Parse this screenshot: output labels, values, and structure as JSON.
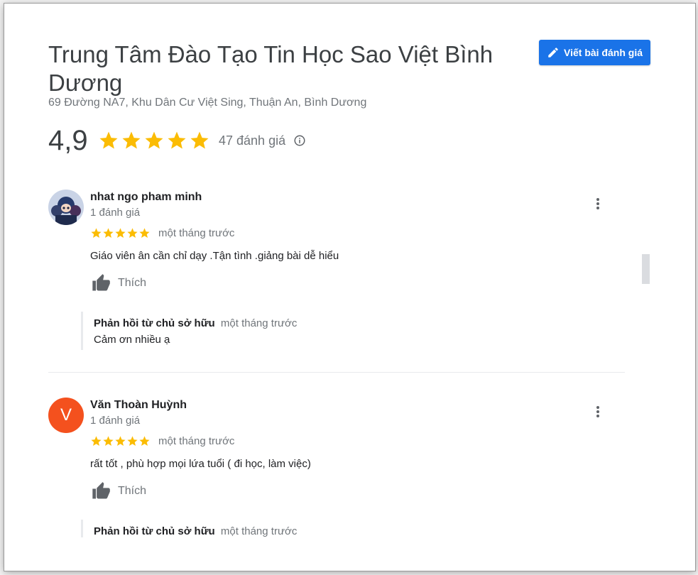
{
  "place": {
    "title": "Trung Tâm Đào Tạo Tin Học Sao Việt Bình Dương",
    "address": "69 Đường NA7, Khu Dân Cư Việt Sing, Thuận An, Bình Dương",
    "rating": "4,9",
    "rating_stars": 5,
    "review_count_label": "47 đánh giá"
  },
  "actions": {
    "write_review_label": "Viết bài đánh giá"
  },
  "reviews": [
    {
      "author": "nhat ngo pham minh",
      "author_reviews": "1 đánh giá",
      "stars": 5,
      "time": "một tháng trước",
      "text": "Giáo viên ân cần chỉ dạy .Tận tình .giảng bài dễ hiểu",
      "like_label": "Thích",
      "owner_reply": {
        "label": "Phản hồi từ chủ sở hữu",
        "time": "một tháng trước",
        "text": "Cảm ơn nhiều ạ"
      }
    },
    {
      "author": "Văn Thoàn Huỳnh",
      "avatar_letter": "V",
      "author_reviews": "1 đánh giá",
      "stars": 5,
      "time": "một tháng trước",
      "text": "rất tốt , phù hợp mọi lứa tuổi ( đi học, làm việc)",
      "like_label": "Thích",
      "owner_reply": {
        "label": "Phản hồi từ chủ sở hữu",
        "time": "một tháng trước",
        "text": ""
      }
    }
  ],
  "colors": {
    "accent": "#1a73e8",
    "star": "#fbbc04",
    "avatar_v": "#f4511e",
    "text_primary": "#202124",
    "text_secondary": "#70757a"
  },
  "icons": [
    "pencil-icon",
    "star-icon",
    "info-icon",
    "thumbs-up-icon",
    "more-vert-icon"
  ]
}
